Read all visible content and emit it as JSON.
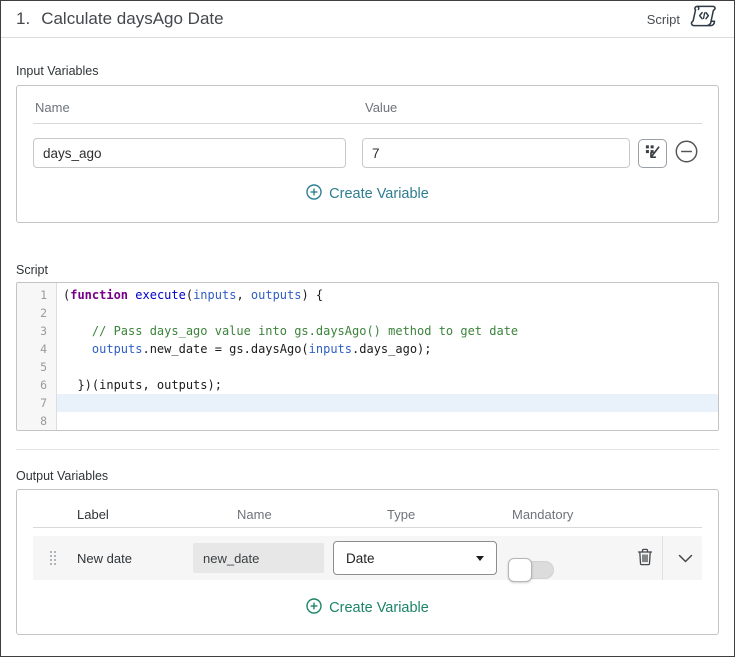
{
  "header": {
    "step_number": "1.",
    "title": "Calculate daysAgo Date",
    "type_label": "Script"
  },
  "input_variables": {
    "section_label": "Input Variables",
    "columns": [
      "Name",
      "Value"
    ],
    "rows": [
      {
        "name": "days_ago",
        "value": "7"
      }
    ],
    "create_label": "Create Variable"
  },
  "script": {
    "section_label": "Script",
    "lines": [
      {
        "no": "1",
        "active": false,
        "tokens": [
          {
            "t": "(",
            "s": "plain"
          },
          {
            "t": "function",
            "s": "keyword"
          },
          {
            "t": " ",
            "s": "plain"
          },
          {
            "t": "execute",
            "s": "def"
          },
          {
            "t": "(",
            "s": "plain"
          },
          {
            "t": "inputs",
            "s": "variable"
          },
          {
            "t": ", ",
            "s": "plain"
          },
          {
            "t": "outputs",
            "s": "variable"
          },
          {
            "t": ") {",
            "s": "plain"
          }
        ]
      },
      {
        "no": "2",
        "active": false,
        "tokens": []
      },
      {
        "no": "3",
        "active": false,
        "tokens": [
          {
            "t": "    ",
            "s": "plain"
          },
          {
            "t": "// Pass days_ago value into gs.daysAgo() method to get date",
            "s": "comment"
          }
        ]
      },
      {
        "no": "4",
        "active": false,
        "tokens": [
          {
            "t": "    ",
            "s": "plain"
          },
          {
            "t": "outputs",
            "s": "variable"
          },
          {
            "t": ".new_date = gs.daysAgo(",
            "s": "plain"
          },
          {
            "t": "inputs",
            "s": "variable"
          },
          {
            "t": ".days_ago);",
            "s": "plain"
          }
        ]
      },
      {
        "no": "5",
        "active": false,
        "tokens": []
      },
      {
        "no": "6",
        "active": false,
        "tokens": [
          {
            "t": "  })(inputs, outputs);",
            "s": "plain"
          }
        ]
      },
      {
        "no": "7",
        "active": true,
        "tokens": []
      },
      {
        "no": "8",
        "active": false,
        "tokens": []
      }
    ]
  },
  "output_variables": {
    "section_label": "Output Variables",
    "columns": [
      "Label",
      "Name",
      "Type",
      "Mandatory"
    ],
    "rows": [
      {
        "label": "New date",
        "name": "new_date",
        "type": "Date",
        "mandatory": false
      }
    ],
    "create_label": "Create Variable"
  },
  "icons": {
    "header_right": "script-scroll-code-icon",
    "value_field": "data-pill-picker-icon",
    "remove_row": "minus-circle-icon",
    "create_variable": "plus-circle-icon",
    "row_left": "drag-handle-icon",
    "row_delete": "trash-icon",
    "row_expand": "chevron-down-icon"
  },
  "colors": {
    "create_link_input": "#2e7e91",
    "create_link_output": "#1d8468",
    "code_keyword": "#770088",
    "code_def": "#0000c8",
    "code_variable": "#2f5fc4",
    "code_comment": "#3c833c",
    "active_line_bg": "#e9f2fb",
    "row_bg": "#f6f6f7",
    "readonly_field_bg": "#e7e7e8"
  }
}
